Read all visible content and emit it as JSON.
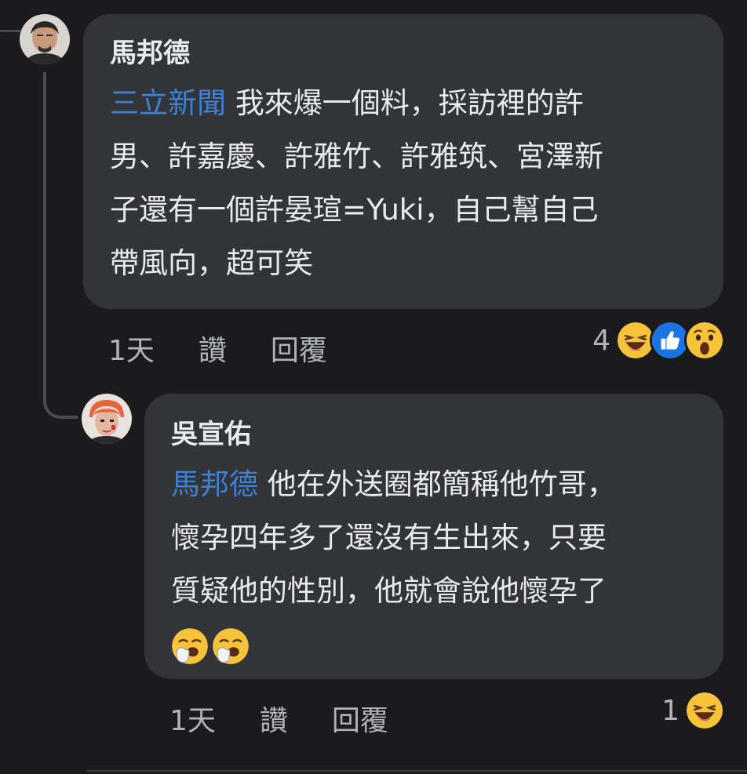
{
  "comments": [
    {
      "author": "馬邦德",
      "mention": "三立新聞",
      "lines": [
        " 我來爆一個料，採訪裡的許",
        "男、許嘉慶、許雅竹、許雅筑、宮澤新",
        "子還有一個許晏瑄=Yuki，自己幫自己",
        "帶風向，超可笑"
      ],
      "time": "1天",
      "like_label": "讚",
      "reply_label": "回覆",
      "reaction_count": "4",
      "reactions": [
        "haha-icon",
        "like-icon",
        "wow-icon"
      ]
    },
    {
      "author": "吳宣佑",
      "mention": "馬邦德",
      "lines": [
        " 他在外送圈都簡稱他竹哥，",
        "懷孕四年多了還沒有生出來，只要",
        "質疑他的性別，他就會說他懷孕了"
      ],
      "emojis": [
        "yawning-face-icon",
        "yawning-face-icon"
      ],
      "time": "1天",
      "like_label": "讚",
      "reply_label": "回覆",
      "reaction_count": "1",
      "reactions": [
        "haha-icon"
      ]
    }
  ],
  "colors": {
    "background": "#1b1b1d",
    "bubble": "#333438",
    "mention": "#3b82d6",
    "meta_text": "#b0b3b8"
  }
}
